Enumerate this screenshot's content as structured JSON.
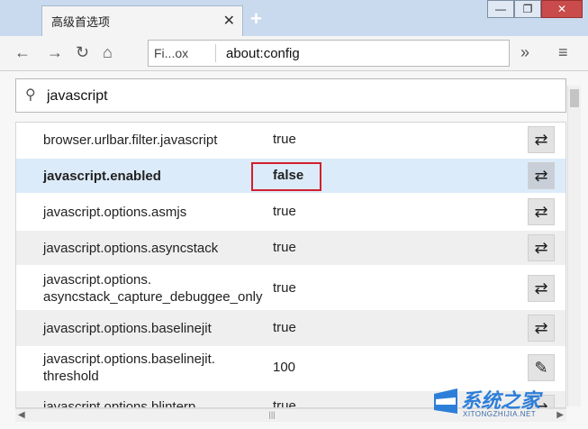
{
  "tab": {
    "title": "高级首选项",
    "close": "✕"
  },
  "newtab": "+",
  "window": {
    "minimize": "—",
    "restore": "❐",
    "close": "✕"
  },
  "nav": {
    "back": "←",
    "forward": "→",
    "reload": "↻",
    "home": "⌂",
    "overflow": "»",
    "menu": "≡"
  },
  "url": {
    "site": "Fi...ox",
    "text": "about:config"
  },
  "search": {
    "value": "javascript",
    "icon": "search-icon"
  },
  "rows": [
    {
      "name": "browser.urlbar.filter.javascript",
      "value": "true",
      "action": "⇄",
      "bold": false
    },
    {
      "name": "javascript.enabled",
      "value": "false",
      "action": "⇄",
      "bold": true
    },
    {
      "name": "javascript.options.asmjs",
      "value": "true",
      "action": "⇄",
      "bold": false
    },
    {
      "name": "javascript.options.asyncstack",
      "value": "true",
      "action": "⇄",
      "bold": false
    },
    {
      "name1": "javascript.options.",
      "name2": "asyncstack_capture_debuggee_only",
      "value": "true",
      "action": "⇄",
      "bold": false
    },
    {
      "name": "javascript.options.baselinejit",
      "value": "true",
      "action": "⇄",
      "bold": false
    },
    {
      "name1": "javascript.options.baselinejit.",
      "name2": "threshold",
      "value": "100",
      "action": "✎",
      "bold": false
    },
    {
      "name": "javascript.options.blinterp",
      "value": "true",
      "action": "⇄",
      "bold": false
    }
  ],
  "scroll": {
    "left": "◀",
    "right": "▶",
    "up": "▲",
    "thumb": "|||"
  },
  "watermark": {
    "brand": "XITONGZHIJIA.NET",
    "logo": "系统之家"
  }
}
